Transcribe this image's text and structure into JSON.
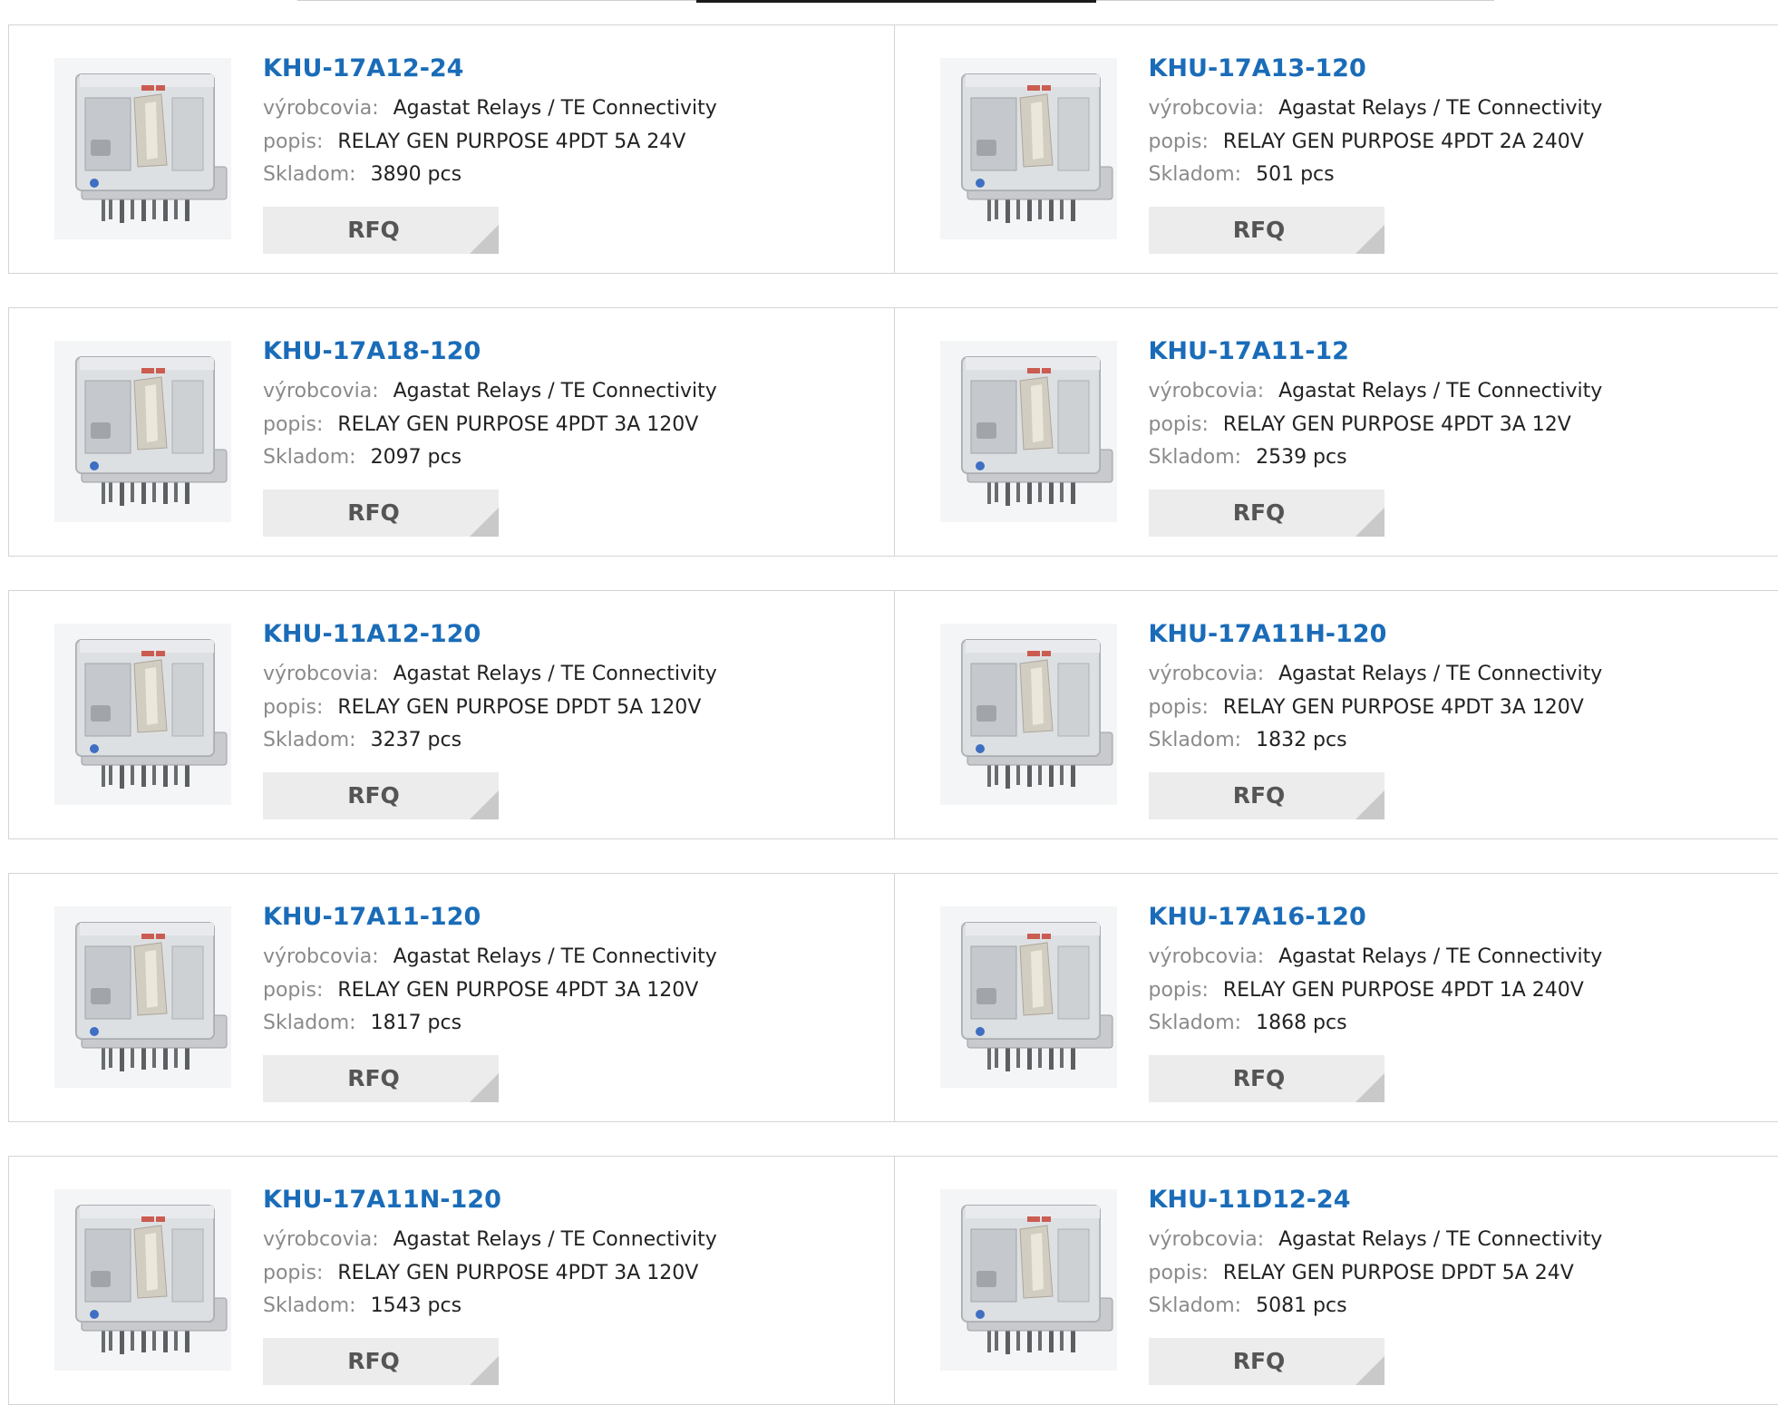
{
  "labels": {
    "manufacturer": "výrobcovia:",
    "description": "popis:",
    "stock": "Skladom:",
    "rfq": "RFQ"
  },
  "products": [
    {
      "part": "KHU-17A12-24",
      "manufacturer": "Agastat Relays / TE Connectivity",
      "description": "RELAY GEN PURPOSE 4PDT 5A 24V",
      "stock": "3890 pcs"
    },
    {
      "part": "KHU-17A13-120",
      "manufacturer": "Agastat Relays / TE Connectivity",
      "description": "RELAY GEN PURPOSE 4PDT 2A 240V",
      "stock": "501 pcs"
    },
    {
      "part": "KHU-17A18-120",
      "manufacturer": "Agastat Relays / TE Connectivity",
      "description": "RELAY GEN PURPOSE 4PDT 3A 120V",
      "stock": "2097 pcs"
    },
    {
      "part": "KHU-17A11-12",
      "manufacturer": "Agastat Relays / TE Connectivity",
      "description": "RELAY GEN PURPOSE 4PDT 3A 12V",
      "stock": "2539 pcs"
    },
    {
      "part": "KHU-11A12-120",
      "manufacturer": "Agastat Relays / TE Connectivity",
      "description": "RELAY GEN PURPOSE DPDT 5A 120V",
      "stock": "3237 pcs"
    },
    {
      "part": "KHU-17A11H-120",
      "manufacturer": "Agastat Relays / TE Connectivity",
      "description": "RELAY GEN PURPOSE 4PDT 3A 120V",
      "stock": "1832 pcs"
    },
    {
      "part": "KHU-17A11-120",
      "manufacturer": "Agastat Relays / TE Connectivity",
      "description": "RELAY GEN PURPOSE 4PDT 3A 120V",
      "stock": "1817 pcs"
    },
    {
      "part": "KHU-17A16-120",
      "manufacturer": "Agastat Relays / TE Connectivity",
      "description": "RELAY GEN PURPOSE 4PDT 1A 240V",
      "stock": "1868 pcs"
    },
    {
      "part": "KHU-17A11N-120",
      "manufacturer": "Agastat Relays / TE Connectivity",
      "description": "RELAY GEN PURPOSE 4PDT 3A 120V",
      "stock": "1543 pcs"
    },
    {
      "part": "KHU-11D12-24",
      "manufacturer": "Agastat Relays / TE Connectivity",
      "description": "RELAY GEN PURPOSE DPDT 5A 24V",
      "stock": "5081 pcs"
    }
  ]
}
